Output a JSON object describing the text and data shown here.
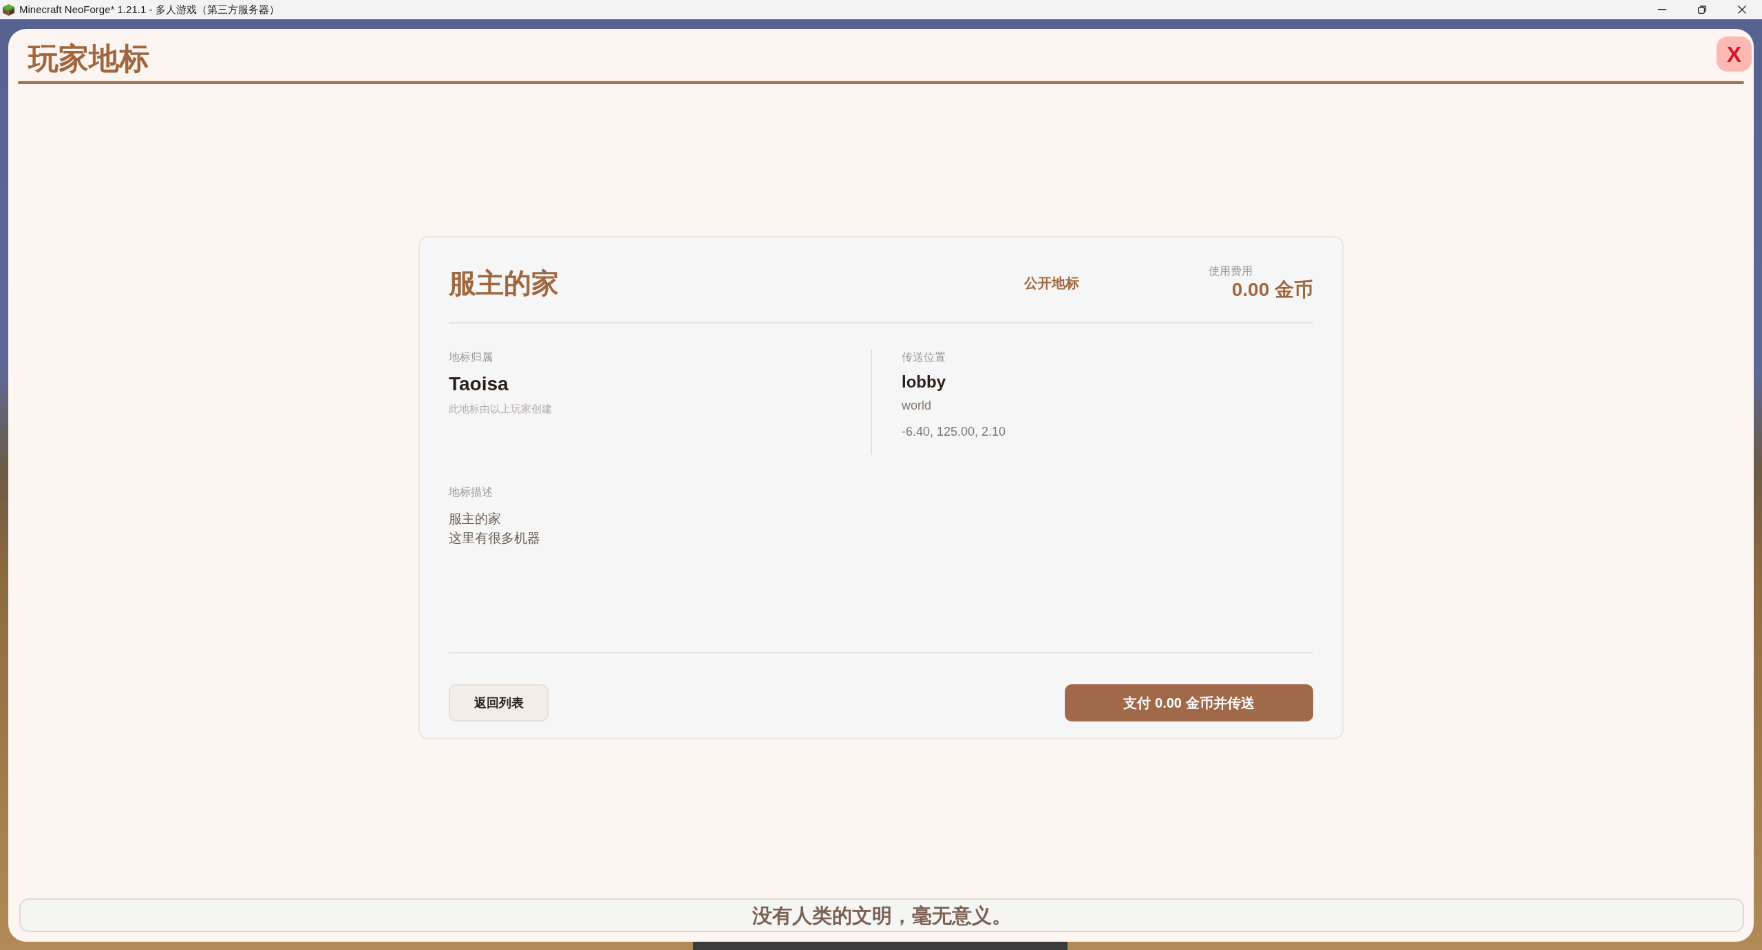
{
  "window": {
    "title": "Minecraft NeoForge* 1.21.1 - 多人游戏（第三方服务器）"
  },
  "screen": {
    "title": "玩家地标",
    "close_label": "X"
  },
  "landmark": {
    "name": "服主的家",
    "visibility": "公开地标",
    "fee_label": "使用费用",
    "fee": "0.00 金币",
    "owner": {
      "label": "地标归属",
      "name": "Taoisa",
      "note": "此地标由以上玩家创建"
    },
    "location": {
      "label": "传送位置",
      "name": "lobby",
      "world": "world",
      "coordinates": "-6.40, 125.00, 2.10"
    },
    "description": {
      "label": "地标描述",
      "lines": [
        "服主的家",
        "这里有很多机器"
      ]
    }
  },
  "buttons": [
    {
      "kind": "secondary",
      "label": "返回列表"
    },
    {
      "kind": "primary",
      "label": "支付 0.00 金币并传送"
    }
  ],
  "footer": {
    "quote": "没有人类的文明，毫无意义。"
  }
}
